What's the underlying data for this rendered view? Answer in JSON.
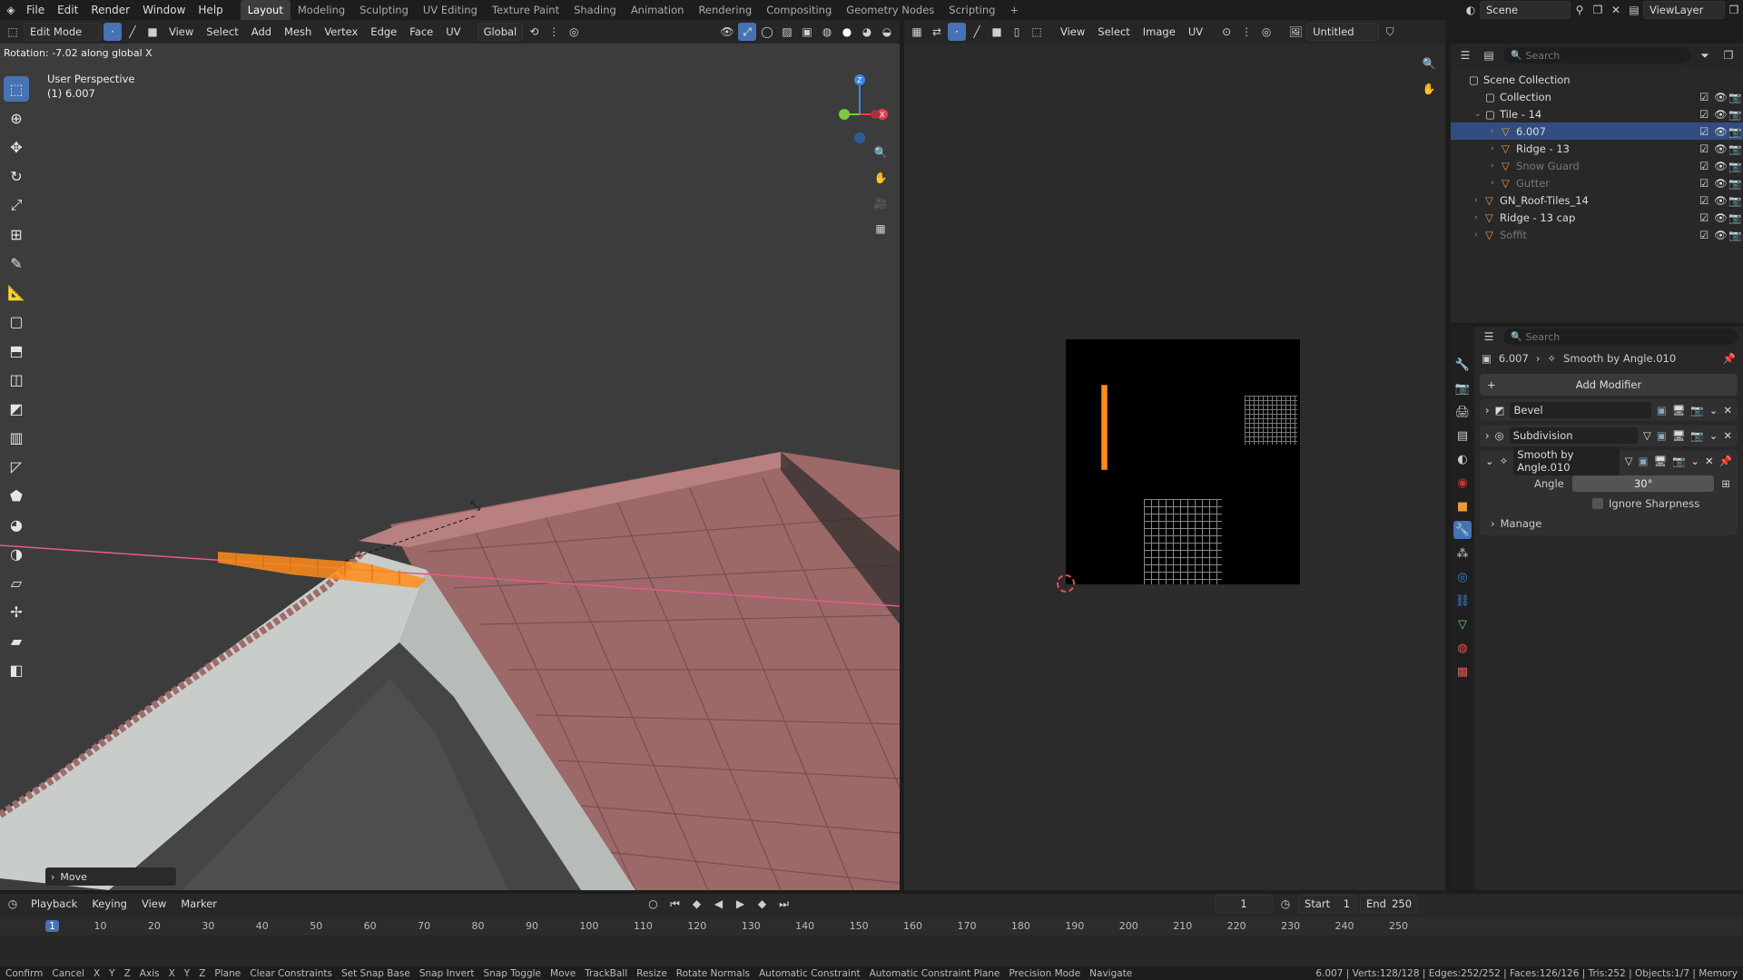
{
  "topmenu": {
    "items": [
      "File",
      "Edit",
      "Render",
      "Window",
      "Help"
    ],
    "workspaces": [
      "Layout",
      "Modeling",
      "Sculpting",
      "UV Editing",
      "Texture Paint",
      "Shading",
      "Animation",
      "Rendering",
      "Compositing",
      "Geometry Nodes",
      "Scripting"
    ],
    "active_workspace": "Layout",
    "scene": "Scene",
    "view_layer": "ViewLayer"
  },
  "viewport_header": {
    "mode": "Edit Mode",
    "menus": [
      "View",
      "Select",
      "Add",
      "Mesh",
      "Vertex",
      "Edge",
      "Face",
      "UV"
    ],
    "orientation": "Global"
  },
  "viewport": {
    "operator_info": "Rotation: -7.02 along global X",
    "view_name": "User Perspective",
    "object_label": "(1) 6.007",
    "last_op": "Move",
    "gizmo_axes": {
      "z": "Z",
      "x": "X"
    }
  },
  "image_header": {
    "menus": [
      "View",
      "Select",
      "Image",
      "UV"
    ],
    "image_name": "Untitled"
  },
  "outliner": {
    "search_placeholder": "Search",
    "items": [
      {
        "label": "Scene Collection",
        "indent": 0
      },
      {
        "label": "Collection",
        "indent": 1
      },
      {
        "label": "Tile - 14",
        "indent": 1
      },
      {
        "label": "6.007",
        "indent": 2,
        "selected": true
      },
      {
        "label": "Ridge - 13",
        "indent": 2
      },
      {
        "label": "Snow Guard",
        "indent": 2,
        "dim": true
      },
      {
        "label": "Gutter",
        "indent": 2,
        "dim": true
      },
      {
        "label": "GN_Roof-Tiles_14",
        "indent": 1
      },
      {
        "label": "Ridge - 13 cap",
        "indent": 1
      },
      {
        "label": "Soffit",
        "indent": 1,
        "dim": true
      }
    ]
  },
  "properties": {
    "search_placeholder": "Search",
    "breadcrumb_object": "6.007",
    "breadcrumb_modifier": "Smooth by Angle.010",
    "add_modifier": "Add Modifier",
    "modifiers": [
      "Bevel",
      "Subdivision",
      "Smooth by Angle.010"
    ],
    "angle_label": "Angle",
    "angle_value": "30°",
    "ignore_sharpness": "Ignore Sharpness",
    "manage": "Manage"
  },
  "timeline": {
    "menus": [
      "Playback",
      "Keying",
      "View",
      "Marker"
    ],
    "current_frame": "1",
    "start_label": "Start",
    "start": "1",
    "end_label": "End",
    "end": "250",
    "ticks": [
      "1",
      "10",
      "20",
      "30",
      "40",
      "50",
      "60",
      "70",
      "80",
      "90",
      "100",
      "110",
      "120",
      "130",
      "140",
      "150",
      "160",
      "170",
      "180",
      "190",
      "200",
      "210",
      "220",
      "230",
      "240",
      "250"
    ]
  },
  "status": {
    "items": [
      "Confirm",
      "Cancel",
      "X",
      "Y",
      "Z",
      "Axis",
      "X",
      "Y",
      "Z",
      "Plane",
      "Clear Constraints",
      "Set Snap Base",
      "Snap Invert",
      "Snap Toggle",
      "Move",
      "TrackBall",
      "Resize",
      "Rotate Normals",
      "Automatic Constraint",
      "Automatic Constraint Plane",
      "Precision Mode",
      "Navigate"
    ],
    "stats": "6.007 | Verts:128/128 | Edges:252/252 | Faces:126/126 | Tris:252 | Objects:1/7 | Memory"
  },
  "colors": {
    "accent": "#4772b3",
    "selection": "#ff8c1a",
    "roof": "#9c6565",
    "axis_x": "#e0404f",
    "axis_y": "#7ac943",
    "axis_z": "#3d86e0"
  }
}
